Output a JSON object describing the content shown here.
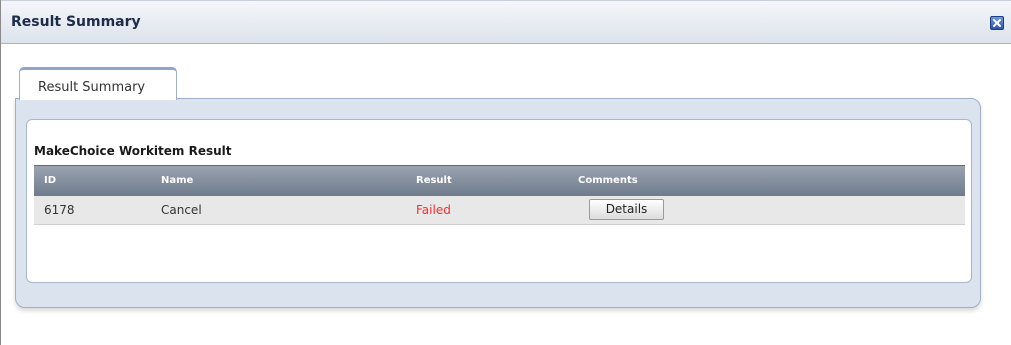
{
  "window": {
    "title": "Result Summary",
    "close_icon": "close-icon"
  },
  "tabs": [
    {
      "label": "Result Summary",
      "active": true
    }
  ],
  "section": {
    "title": "MakeChoice Workitem Result"
  },
  "table": {
    "headers": [
      "ID",
      "Name",
      "Result",
      "Comments"
    ],
    "rows": [
      {
        "id": "6178",
        "name": "Cancel",
        "result": "Failed",
        "comments_button": "Details"
      }
    ]
  },
  "colors": {
    "failed": "#ff2a2a",
    "header_bg": "#7f8a9b",
    "panel_bg": "#dbe3ee"
  }
}
